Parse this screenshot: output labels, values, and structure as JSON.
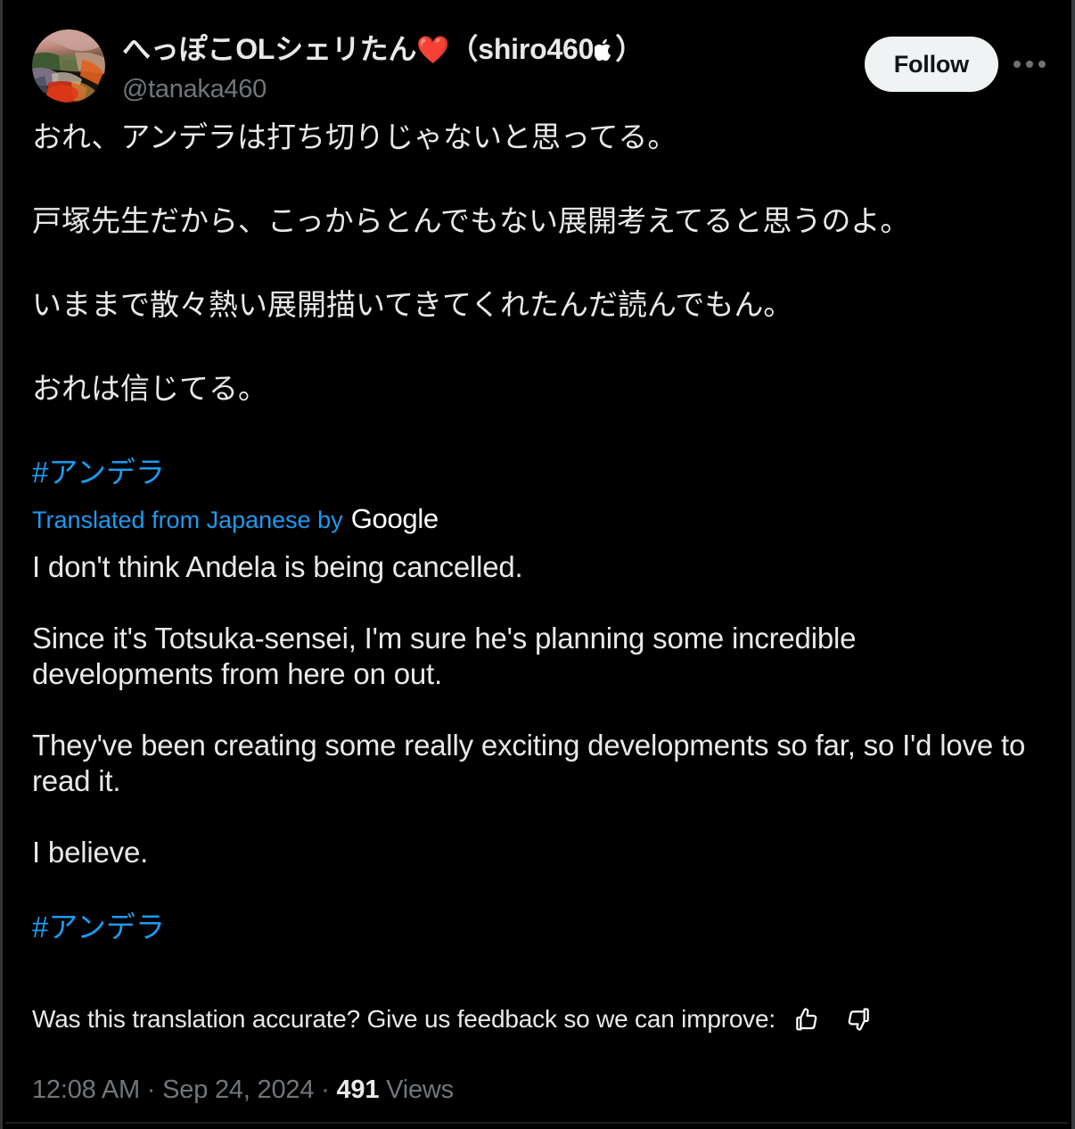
{
  "post": {
    "author": {
      "display_name_text": "へっぽこOLシェリたん",
      "heart_emoji": "❤️",
      "paren_open": "（",
      "suffix_text": "shiro460",
      "apple_icon": "apple-icon",
      "paren_close": "）",
      "handle": "@tanaka460",
      "avatar_alt": "avatar-photo"
    },
    "actions": {
      "follow_label": "Follow",
      "more_label": "more-options"
    },
    "source_paragraphs": [
      "おれ、アンデラは打ち切りじゃないと思ってる。",
      "戸塚先生だから、こっからとんでもない展開考えてると思うのよ。",
      "いままで散々熱い展開描いてきてくれたんだ読んでもん。",
      "おれは信じてる。"
    ],
    "source_hashtag": "#アンデラ",
    "translation": {
      "attribution_prefix": "Translated from Japanese by",
      "provider": "Google",
      "paragraphs": [
        "I don't think Andela is being cancelled.",
        "Since it's Totsuka-sensei, I'm sure he's planning some incredible developments from here on out.",
        "They've been creating some really exciting developments so far, so I'd love to read it.",
        "I believe."
      ],
      "hashtag": "#アンデラ",
      "feedback_prompt": "Was this translation accurate? Give us feedback so we can improve:",
      "thumbs_up_icon": "thumbs-up-icon",
      "thumbs_down_icon": "thumbs-down-icon"
    },
    "meta": {
      "time": "12:08 AM",
      "separator_1": "·",
      "date": "Sep 24, 2024",
      "separator_2": "·",
      "views_count": "491",
      "views_label": "Views"
    }
  },
  "colors": {
    "background": "#000000",
    "text_primary": "#e7e9ea",
    "text_secondary": "#71767b",
    "link_blue": "#1d9bf0",
    "follow_bg": "#eff3f4",
    "follow_text": "#0f1419",
    "heart_red": "#f4334a",
    "divider": "#2f3336"
  }
}
